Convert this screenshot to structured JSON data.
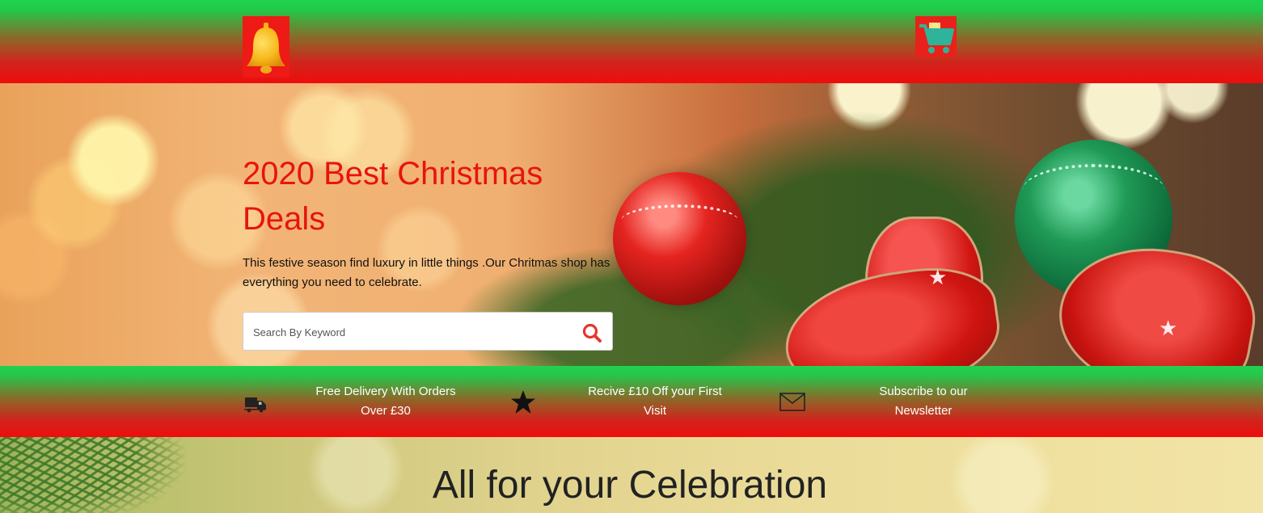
{
  "header": {
    "bell_icon": "bell-icon",
    "cart_icon": "shopping-cart-icon"
  },
  "hero": {
    "title": "2020 Best Christmas Deals",
    "subtitle": "This festive season find luxury in little things .Our Chritmas shop has everything you need to celebrate.",
    "search": {
      "placeholder": "Search By Keyword",
      "value": "",
      "icon": "search-icon"
    }
  },
  "features": [
    {
      "icon": "delivery-truck-icon",
      "text": "Free Delivery With Orders Over £30"
    },
    {
      "icon": "star-icon",
      "text": "Recive £10 Off your First Visit"
    },
    {
      "icon": "envelope-icon",
      "text": "Subscribe to our Newsletter"
    }
  ],
  "section": {
    "heading": "All for your Celebration"
  },
  "colors": {
    "bar_top": "#1ed44e",
    "bar_bottom": "#ee0d0d",
    "title_red": "#e8130f",
    "search_icon_red": "#e8342c"
  }
}
